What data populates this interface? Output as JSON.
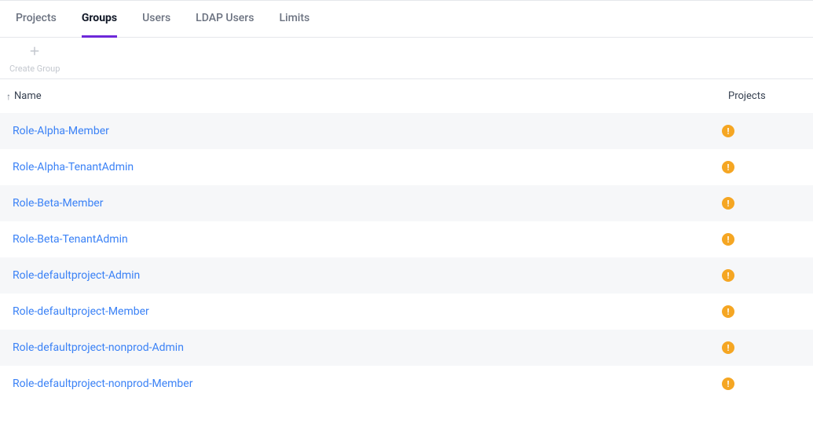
{
  "tabs": [
    {
      "label": "Projects",
      "active": false
    },
    {
      "label": "Groups",
      "active": true
    },
    {
      "label": "Users",
      "active": false
    },
    {
      "label": "LDAP Users",
      "active": false
    },
    {
      "label": "Limits",
      "active": false
    }
  ],
  "toolbar": {
    "create_group_label": "Create Group"
  },
  "table": {
    "headers": {
      "name": "Name",
      "projects": "Projects",
      "sort_direction": "↑"
    },
    "rows": [
      {
        "name": "Role-Alpha-Member",
        "projects_status": "warning"
      },
      {
        "name": "Role-Alpha-TenantAdmin",
        "projects_status": "warning"
      },
      {
        "name": "Role-Beta-Member",
        "projects_status": "warning"
      },
      {
        "name": "Role-Beta-TenantAdmin",
        "projects_status": "warning"
      },
      {
        "name": "Role-defaultproject-Admin",
        "projects_status": "warning"
      },
      {
        "name": "Role-defaultproject-Member",
        "projects_status": "warning"
      },
      {
        "name": "Role-defaultproject-nonprod-Admin",
        "projects_status": "warning"
      },
      {
        "name": "Role-defaultproject-nonprod-Member",
        "projects_status": "warning"
      }
    ]
  }
}
